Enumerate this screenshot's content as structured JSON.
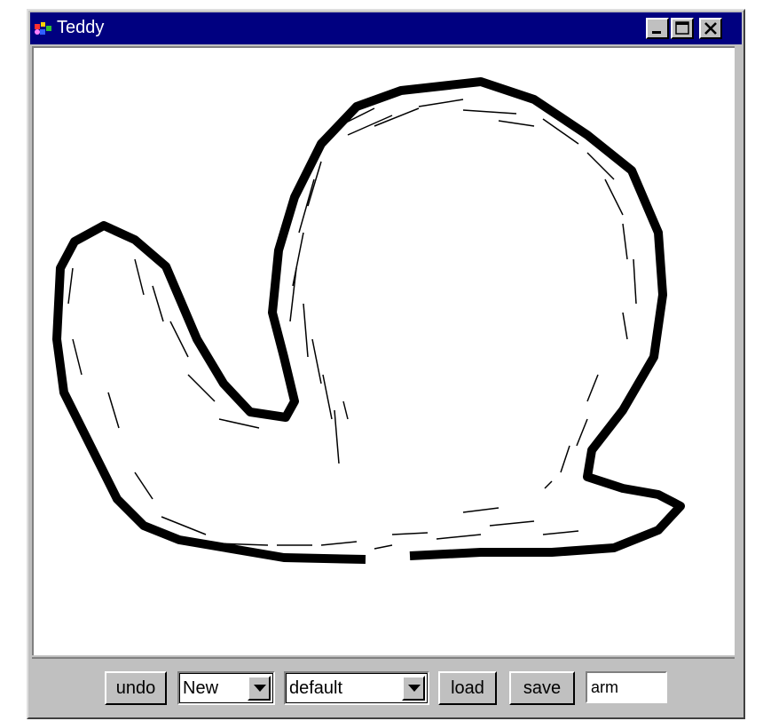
{
  "window": {
    "title": "Teddy",
    "controls": {
      "minimize_icon": "minimize-icon",
      "maximize_icon": "maximize-icon",
      "close_icon": "close-icon"
    }
  },
  "colors": {
    "titlebar": "#000080",
    "chrome": "#c0c0c0",
    "canvas": "#ffffff",
    "stroke": "#000000"
  },
  "toolbar": {
    "undo_label": "undo",
    "mode_select": {
      "value": "New"
    },
    "preset_select": {
      "value": "default"
    },
    "load_label": "load",
    "save_label": "save",
    "name_input_value": "arm"
  }
}
